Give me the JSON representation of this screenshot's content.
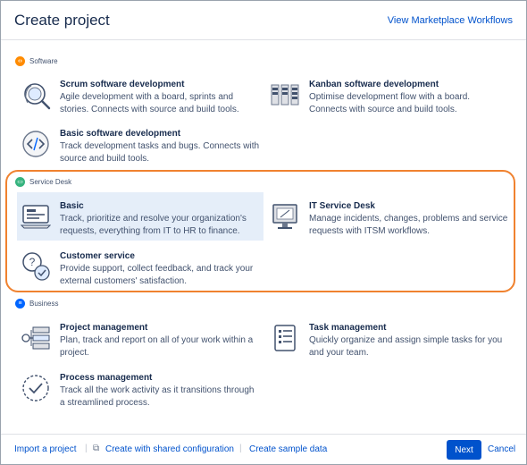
{
  "dialog": {
    "title": "Create project",
    "header_link": "View Marketplace Workflows"
  },
  "sections": {
    "software": {
      "label": "Software",
      "color": "#ff8b00",
      "items": {
        "scrum": {
          "name": "Scrum software development",
          "desc": "Agile development with a board, sprints and stories. Connects with source and build tools.",
          "icon": "magnifier-loop-icon"
        },
        "kanban": {
          "name": "Kanban software development",
          "desc": "Optimise development flow with a board. Connects with source and build tools.",
          "icon": "kanban-board-icon"
        },
        "basic": {
          "name": "Basic software development",
          "desc": "Track development tasks and bugs. Connects with source and build tools.",
          "icon": "code-brackets-icon"
        }
      }
    },
    "service_desk": {
      "label": "Service Desk",
      "color": "#36b37e",
      "items": {
        "basic": {
          "name": "Basic",
          "desc": "Track, prioritize and resolve your organization's requests, everything from IT to HR to finance.",
          "icon": "laptop-form-icon"
        },
        "it": {
          "name": "IT Service Desk",
          "desc": "Manage incidents, changes, problems and service requests with ITSM workflows.",
          "icon": "monitor-icon"
        },
        "customer": {
          "name": "Customer service",
          "desc": "Provide support, collect feedback, and track your external customers' satisfaction.",
          "icon": "question-bubble-icon"
        }
      }
    },
    "business": {
      "label": "Business",
      "color": "#0065ff",
      "items": {
        "project": {
          "name": "Project management",
          "desc": "Plan, track and report on all of your work within a project.",
          "icon": "process-steps-icon"
        },
        "task": {
          "name": "Task management",
          "desc": "Quickly organize and assign simple tasks for you and your team.",
          "icon": "checklist-icon"
        },
        "process": {
          "name": "Process management",
          "desc": "Track all the work activity as it transitions through a streamlined process.",
          "icon": "circle-check-icon"
        }
      }
    }
  },
  "footer": {
    "import": "Import a project",
    "shared_config": "Create with shared configuration",
    "sample_data": "Create sample data",
    "next": "Next",
    "cancel": "Cancel"
  }
}
